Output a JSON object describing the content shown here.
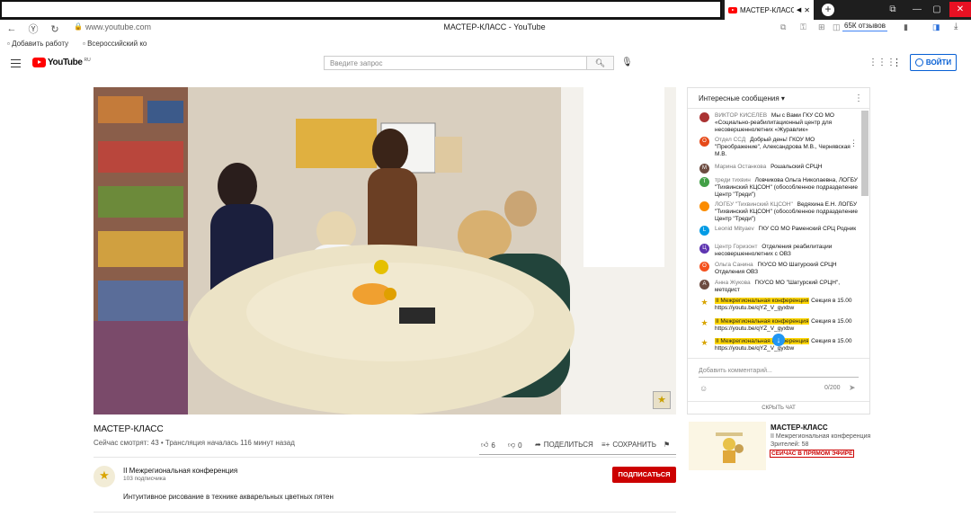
{
  "browser": {
    "tab_title": "МАСТЕР-КЛАСС",
    "new_tab": "+",
    "url": "www.youtube.com",
    "page_title": "МАСТЕР-КЛАСС - YouTube",
    "reviews": "65К отзывов",
    "bookmarks": [
      "Добавить работу",
      "Всероссийский ко"
    ]
  },
  "header": {
    "logo_text": "YouTube",
    "logo_region": "RU",
    "search_placeholder": "Введите запрос",
    "signin_label": "ВОЙТИ"
  },
  "video": {
    "title": "МАСТЕР-КЛАСС",
    "meta": "Сейчас смотрят: 43 • Трансляция началась 116 минут назад",
    "likes": "6",
    "dislikes": "0",
    "share_label": "ПОДЕЛИТЬСЯ",
    "save_label": "СОХРАНИТЬ"
  },
  "channel": {
    "name": "II Межрегиональная конференция",
    "subscribers": "103 подписчика",
    "description": "Интуитивное рисование в технике акварельных цветных пятен",
    "subscribe_label": "ПОДПИСАТЬСЯ"
  },
  "chat": {
    "header": "Интересные сообщения",
    "messages": [
      {
        "author": "ВИКТОР КИСЕЛЕВ",
        "text": "Мы с Вами ГКУ СО МО «Социально-реабилитационный центр для несовершеннолетних «Журавлик»",
        "avatar": "",
        "color": "#a33"
      },
      {
        "author": "Отдел ССД",
        "text": "Добрый день! ГКОУ МО \"Преображение\", Александрова М.В., Чернявская М.В.",
        "avatar": "О",
        "color": "#e64a19"
      },
      {
        "author": "Марина Останкова",
        "text": "Рошальский СРЦН",
        "avatar": "М",
        "color": "#6d4c41"
      },
      {
        "author": "треди тихвин",
        "text": "Ловчикова Ольга Николаевна, ЛОГБУ \"Тихвинский КЦСОН\" (обособленное подразделение Центр \"Треди\")",
        "avatar": "Т",
        "color": "#43a047"
      },
      {
        "author": "ЛОГБУ \"Тихвинский КЦСОН\"",
        "text": "Ведяхина Е.Н. ЛОГБУ \"Тихвинский КЦСОН\" (обособленное подразделение Центр \"Треди\")",
        "avatar": "",
        "color": "#fb8c00"
      },
      {
        "author": "Leonid Mityaev",
        "text": "ГКУ СО МО Раменский СРЦ Родник",
        "avatar": "L",
        "color": "#039be5"
      },
      {
        "author": "Центр Горизонт",
        "text": "Отделения реабилитации несовершеннолетних с ОВЗ",
        "avatar": "Ц",
        "color": "#5e35b1"
      },
      {
        "author": "Ольга Санина",
        "text": "ГКУСО МО Шатурский СРЦН Отделения ОВЗ",
        "avatar": "О",
        "color": "#f4511e"
      },
      {
        "author": "Анна Жукова",
        "text": "ГКУСО МО \"Шатурский СРЦН\", методист",
        "avatar": "А",
        "color": "#6d4c41"
      },
      {
        "author": "II Межрегиональная конференция",
        "text": "Секция в 15.00 https://youtu.be/qYZ_V_gyxbw",
        "avatar": "★",
        "color": "#ffffff"
      },
      {
        "author": "II Межрегиональная конференция",
        "text": "Секция в 15.00 https://youtu.be/qYZ_V_gyxbw",
        "avatar": "★",
        "color": "#ffffff"
      },
      {
        "author": "II Межрегиональная конференция",
        "text": "Секция в 15.00 https://youtu.be/qYZ_V_gyxbw",
        "avatar": "★",
        "color": "#ffffff"
      }
    ],
    "input_placeholder": "Добавить комментарий...",
    "counter": "0/200",
    "hide_label": "СКРЫТЬ ЧАТ"
  },
  "recommended": {
    "title": "МАСТЕР-КЛАСС",
    "channel": "II Межрегиональная конференция",
    "viewers": "Зрителей: 58",
    "live_badge": "СЕЙЧАС В ПРЯМОМ ЭФИРЕ"
  },
  "colors": {
    "accent": "#065fd4",
    "subscribe": "#cc0000",
    "highlight": "#ffd600"
  }
}
